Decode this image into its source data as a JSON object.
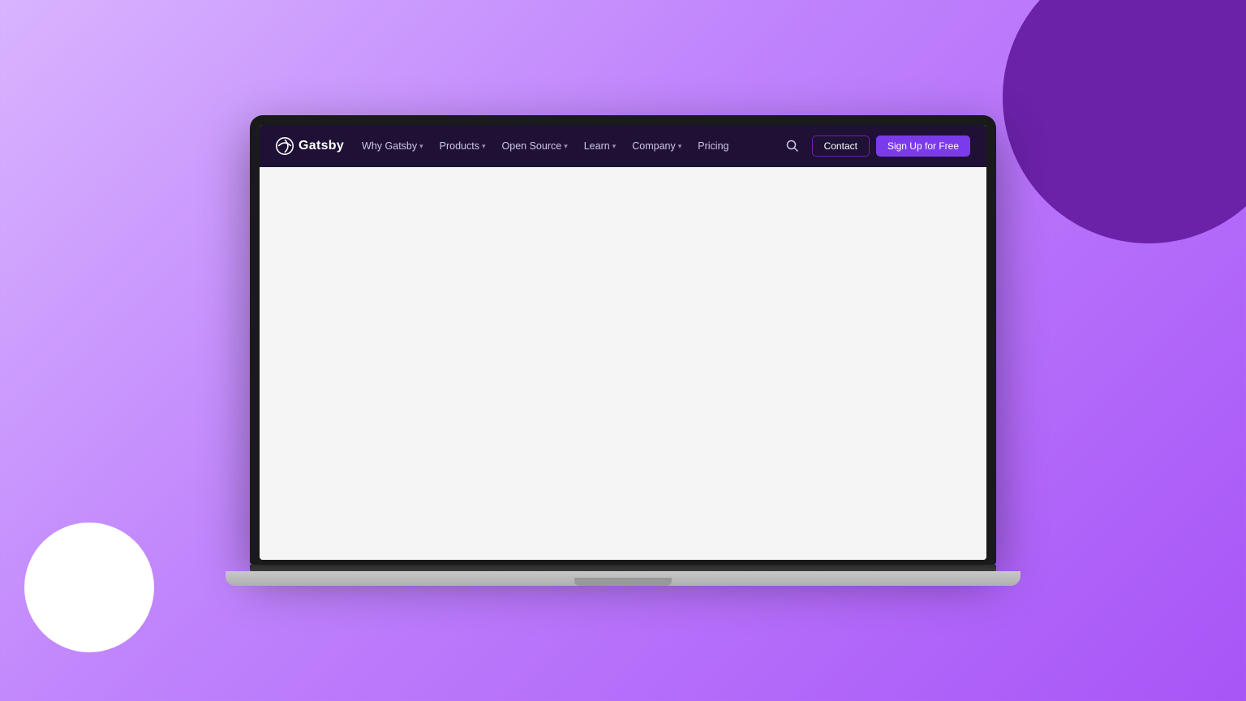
{
  "background": {
    "color": "#c084fc"
  },
  "navbar": {
    "logo_text": "Gatsby",
    "nav_items": [
      {
        "label": "Why Gatsby",
        "has_dropdown": true
      },
      {
        "label": "Products",
        "has_dropdown": true
      },
      {
        "label": "Open Source",
        "has_dropdown": true
      },
      {
        "label": "Learn",
        "has_dropdown": true
      },
      {
        "label": "Company",
        "has_dropdown": true
      },
      {
        "label": "Pricing",
        "has_dropdown": false
      }
    ],
    "contact_label": "Contact",
    "signup_label": "Sign Up for Free",
    "search_icon": "🔍"
  }
}
